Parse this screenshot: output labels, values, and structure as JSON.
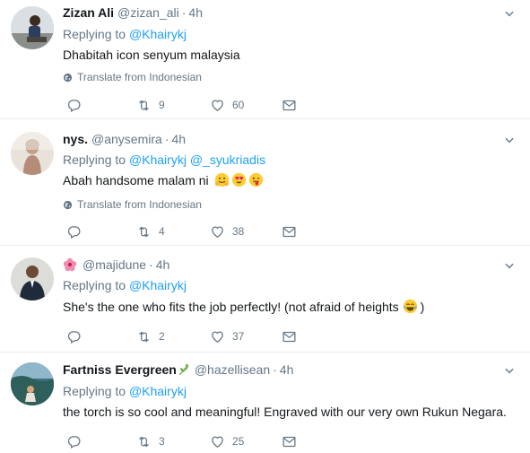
{
  "tweets": [
    {
      "name": "Zizan Ali",
      "handle": "@zizan_ali",
      "time": "4h",
      "reply_prefix": "Replying to ",
      "mentions": [
        "@Khairykj"
      ],
      "text": "Dhabitah icon senyum malaysia",
      "translate": "Translate from Indonesian",
      "retweets": "9",
      "likes": "60"
    },
    {
      "name": "nys.",
      "handle": "@anysemira",
      "time": "4h",
      "reply_prefix": "Replying to ",
      "mentions": [
        "@Khairykj",
        "@_syukriadis"
      ],
      "text": "Abah handsome malam ni",
      "translate": "Translate from Indonesian",
      "retweets": "4",
      "likes": "38"
    },
    {
      "name": "",
      "handle": "@majidune",
      "time": "4h",
      "reply_prefix": "Replying to ",
      "mentions": [
        "@Khairykj"
      ],
      "text": "She's the one who fits the job perfectly! (not afraid of heights",
      "text_end": ")",
      "retweets": "2",
      "likes": "37"
    },
    {
      "name": "Fartniss Evergreen",
      "handle": "@hazellisean",
      "time": "4h",
      "reply_prefix": "Replying to ",
      "mentions": [
        "@Khairykj"
      ],
      "text": "the torch is so cool and meaningful! Engraved with our very own Rukun Negara.",
      "retweets": "3",
      "likes": "25"
    }
  ],
  "separator": "·",
  "colors": {
    "link": "#1da1f2",
    "muted": "#657786",
    "text": "#14171a",
    "divider": "#e6ecf0"
  },
  "icons": [
    "reply-icon",
    "retweet-icon",
    "heart-icon",
    "envelope-icon",
    "globe-icon",
    "chevron-down-icon"
  ]
}
